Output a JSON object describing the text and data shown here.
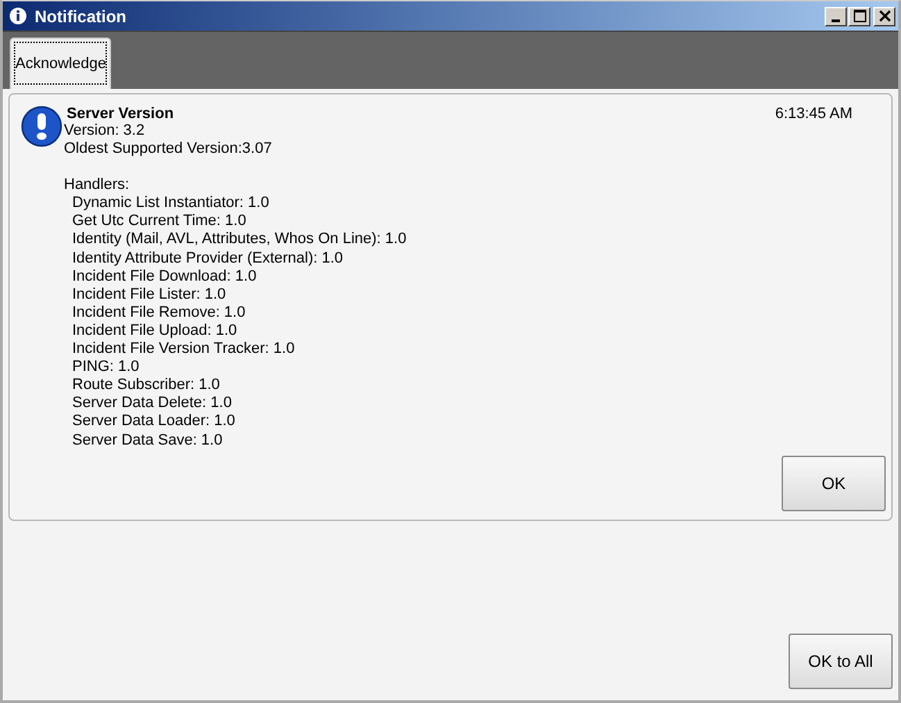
{
  "window": {
    "title": "Notification"
  },
  "tabs": [
    {
      "label": "Acknowledge",
      "selected": true
    }
  ],
  "message": {
    "title": "Server Version",
    "time": "6:13:45 AM",
    "lines": [
      "Version: 3.2",
      "Oldest Supported Version:3.07"
    ],
    "handlers_label": "Handlers:",
    "handlers": [
      "Dynamic List Instantiator: 1.0",
      "Get Utc Current Time: 1.0",
      "Identity (Mail, AVL, Attributes, Whos On Line): 1.0",
      "Identity Attribute Provider (External): 1.0",
      "Incident File Download: 1.0",
      "Incident File Lister: 1.0",
      "Incident File Remove: 1.0",
      "Incident File Upload: 1.0",
      "Incident File Version Tracker: 1.0",
      "PING: 1.0",
      "Route Subscriber: 1.0",
      "Server Data Delete: 1.0",
      "Server Data Loader: 1.0",
      "Server Data Save: 1.0"
    ],
    "button": "OK"
  },
  "footer_button": "OK to All"
}
